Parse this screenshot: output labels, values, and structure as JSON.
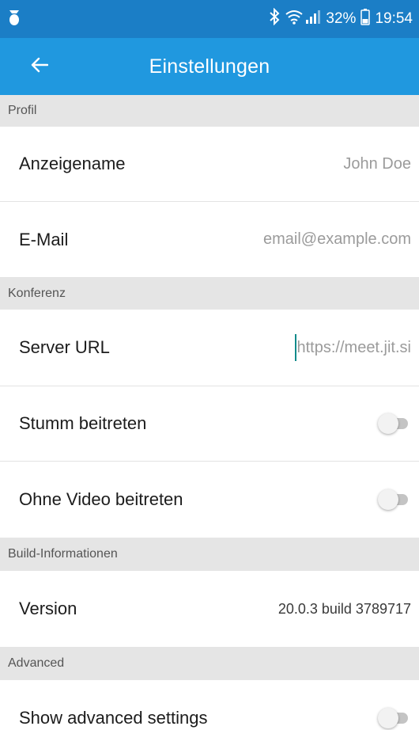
{
  "status_bar": {
    "notification_icon": "notification-icon",
    "bluetooth_icon": "bluetooth-icon",
    "wifi_icon": "wifi-icon",
    "signal_icon": "signal-icon",
    "battery_percent": "32%",
    "battery_icon": "battery-icon",
    "time": "19:54"
  },
  "app_bar": {
    "back_icon": "back-arrow-icon",
    "title": "Einstellungen",
    "color": "#2098df",
    "status_color": "#1b7ec6"
  },
  "sections": {
    "profil": {
      "header": "Profil",
      "display_name": {
        "label": "Anzeigename",
        "placeholder": "John Doe"
      },
      "email": {
        "label": "E-Mail",
        "placeholder": "email@example.com"
      }
    },
    "konferenz": {
      "header": "Konferenz",
      "server_url": {
        "label": "Server URL",
        "placeholder": "https://meet.jit.si"
      },
      "mute": {
        "label": "Stumm beitreten",
        "enabled": false
      },
      "no_video": {
        "label": "Ohne Video beitreten",
        "enabled": false
      }
    },
    "build": {
      "header": "Build-Informationen",
      "version": {
        "label": "Version",
        "value": "20.0.3 build 3789717"
      }
    },
    "advanced": {
      "header": "Advanced",
      "show_advanced": {
        "label": "Show advanced settings",
        "enabled": false
      }
    }
  }
}
